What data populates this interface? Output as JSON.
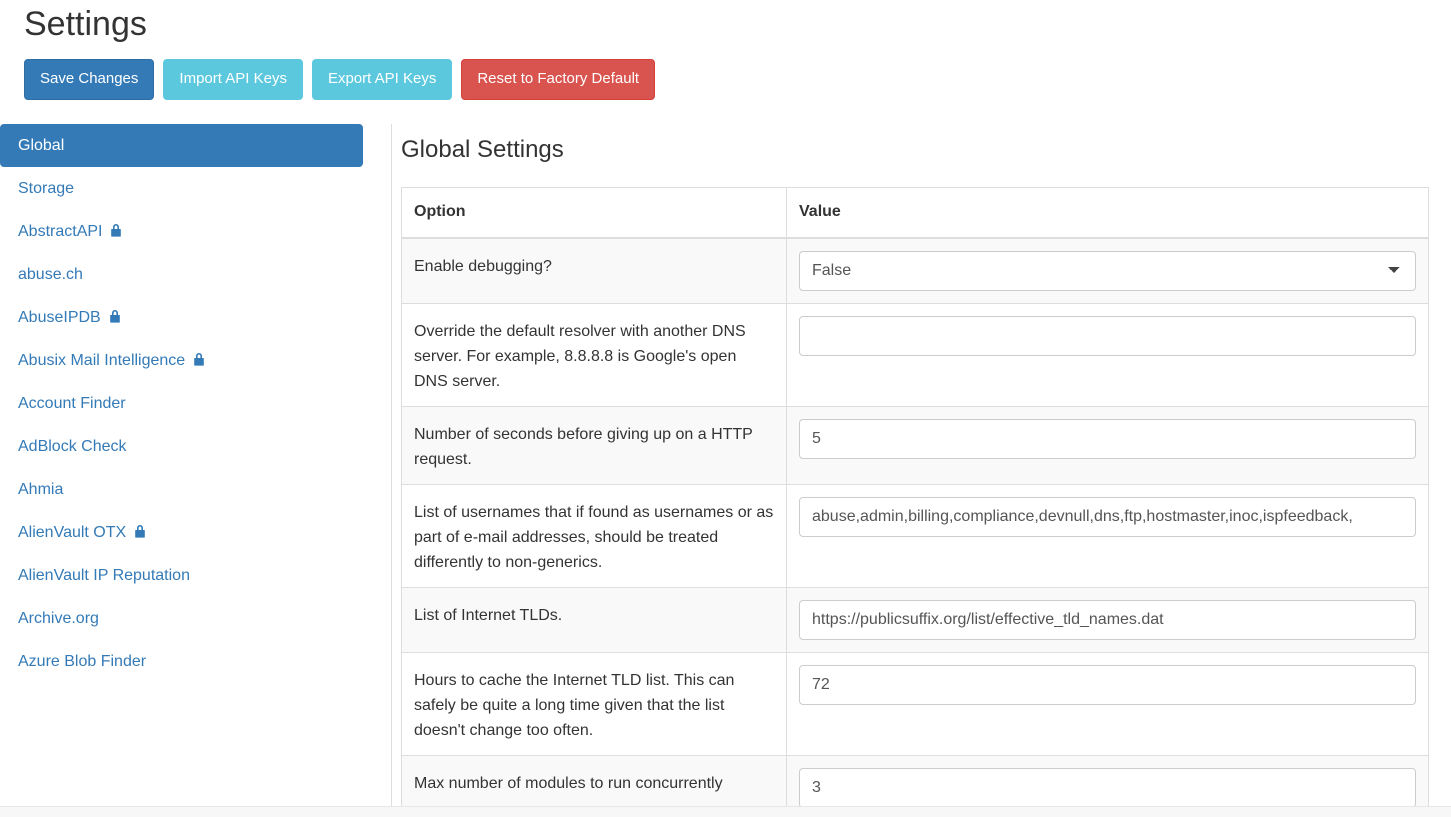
{
  "header": {
    "title": "Settings",
    "buttons": [
      {
        "label": "Save Changes",
        "style": "primary"
      },
      {
        "label": "Import API Keys",
        "style": "info"
      },
      {
        "label": "Export API Keys",
        "style": "info"
      },
      {
        "label": "Reset to Factory Default",
        "style": "danger"
      }
    ]
  },
  "sidebar": {
    "items": [
      {
        "label": "Global",
        "locked": false,
        "active": true
      },
      {
        "label": "Storage",
        "locked": false,
        "active": false
      },
      {
        "label": "AbstractAPI",
        "locked": true,
        "active": false
      },
      {
        "label": "abuse.ch",
        "locked": false,
        "active": false
      },
      {
        "label": "AbuseIPDB",
        "locked": true,
        "active": false
      },
      {
        "label": "Abusix Mail Intelligence",
        "locked": true,
        "active": false
      },
      {
        "label": "Account Finder",
        "locked": false,
        "active": false
      },
      {
        "label": "AdBlock Check",
        "locked": false,
        "active": false
      },
      {
        "label": "Ahmia",
        "locked": false,
        "active": false
      },
      {
        "label": "AlienVault OTX",
        "locked": true,
        "active": false
      },
      {
        "label": "AlienVault IP Reputation",
        "locked": false,
        "active": false
      },
      {
        "label": "Archive.org",
        "locked": false,
        "active": false
      },
      {
        "label": "Azure Blob Finder",
        "locked": false,
        "active": false
      }
    ]
  },
  "main": {
    "title": "Global Settings",
    "table": {
      "headers": [
        "Option",
        "Value"
      ],
      "rows": [
        {
          "option": "Enable debugging?",
          "type": "select",
          "value": "False",
          "options": [
            "False",
            "True"
          ]
        },
        {
          "option": "Override the default resolver with another DNS server. For example, 8.8.8.8 is Google's open DNS server.",
          "type": "text",
          "value": ""
        },
        {
          "option": "Number of seconds before giving up on a HTTP request.",
          "type": "text",
          "value": "5"
        },
        {
          "option": "List of usernames that if found as usernames or as part of e-mail addresses, should be treated differently to non-generics.",
          "type": "text",
          "value": "abuse,admin,billing,compliance,devnull,dns,ftp,hostmaster,inoc,ispfeedback,"
        },
        {
          "option": "List of Internet TLDs.",
          "type": "text",
          "value": "https://publicsuffix.org/list/effective_tld_names.dat"
        },
        {
          "option": "Hours to cache the Internet TLD list. This can safely be quite a long time given that the list doesn't change too often.",
          "type": "text",
          "value": "72"
        },
        {
          "option": "Max number of modules to run concurrently",
          "type": "text",
          "value": "3"
        }
      ]
    }
  },
  "colors": {
    "primary": "#337ab7",
    "info": "#5bc8de",
    "danger": "#d9534f",
    "link": "#337ab7",
    "row_stripe": "#f9f9f9",
    "border": "#dddddd"
  }
}
